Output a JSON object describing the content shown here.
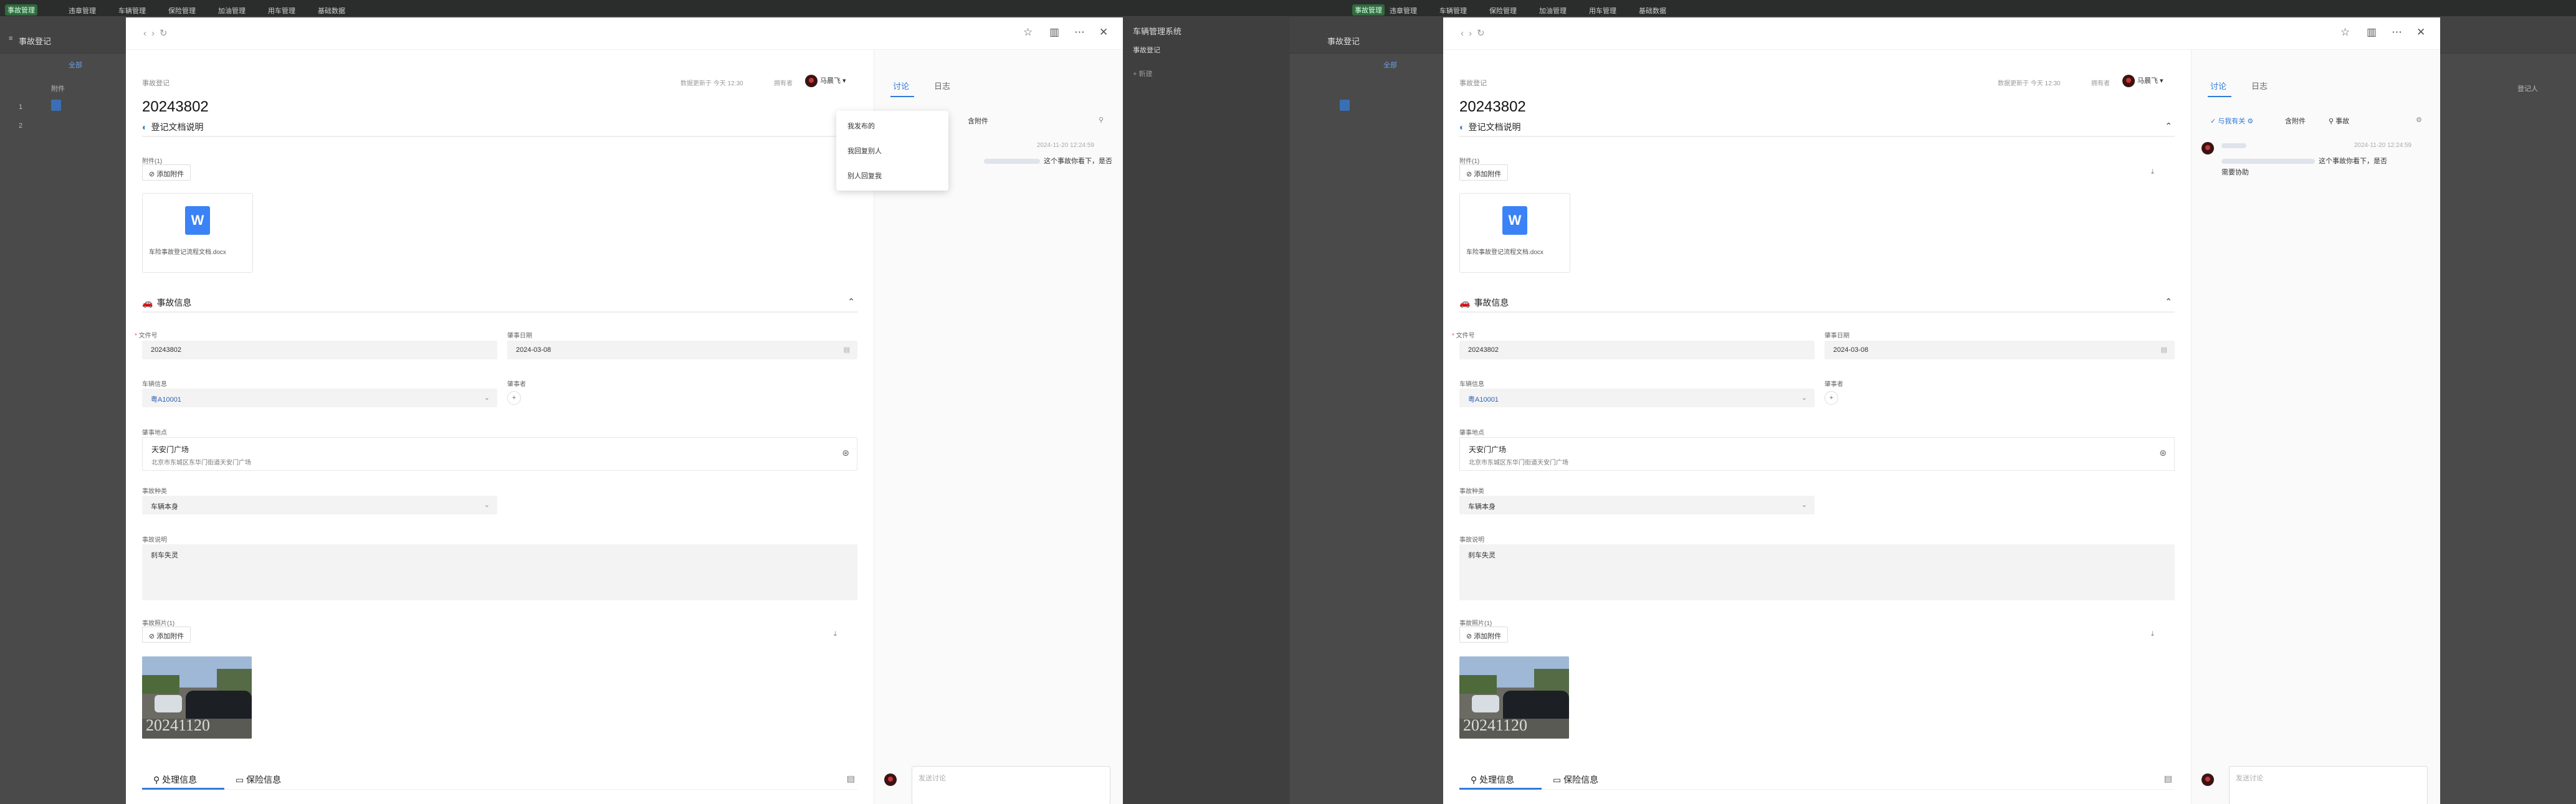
{
  "bg_left": {
    "nav": [
      "事故管理",
      "违章管理",
      "车辆管理",
      "保险管理",
      "加油管理",
      "用车管理",
      "基础数据"
    ],
    "page_title": "事故登记",
    "table_head": [
      "附件"
    ],
    "tab_all": "全部",
    "rows": [
      "1",
      "2"
    ]
  },
  "bg_right": {
    "system_title": "车辆管理系统",
    "sidebar_item": "事故登记",
    "add": "+ 新建",
    "col_head": "登记人"
  },
  "modal": {
    "crumb": "事故登记",
    "doc_no": "20243802",
    "updated": "数据更新于 今天 12:30",
    "owner_label": "拥有者",
    "owner_name": "马晨飞",
    "sections": {
      "attachment_title": "登记文档说明",
      "attachment_count": "附件(1)",
      "add_attachment": "添加附件",
      "file_name": "车险事故登记流程文档.docx",
      "accident_title": "事故信息",
      "process_tab": "处理信息",
      "insurance_tab": "保险信息"
    },
    "fields": {
      "doc_no_label": "文件号",
      "doc_no_value": "20243802",
      "date_label": "肇事日期",
      "date_value": "2024-03-08",
      "vehicle_label": "车辆信息",
      "vehicle_value": "粤A10001",
      "driver_label": "肇事者",
      "place_label": "肇事地点",
      "place_name": "天安门广场",
      "place_address": "北京市东城区东华门街道天安门广场",
      "type_label": "事故种类",
      "type_value": "车辆本身",
      "desc_label": "事故说明",
      "desc_value": "刹车失灵",
      "photo_label": "事故照片(1)",
      "photo_stamp": "20241120"
    }
  },
  "discussion": {
    "tab_discuss": "讨论",
    "tab_log": "日志",
    "filter_me": "与我有关",
    "filter_attach": "含附件",
    "search_value": "事故",
    "time": "2024-11-20 12:24:59",
    "msg_tail": "这个事故你看下，是否",
    "msg_line2": "需要协助",
    "compose_placeholder": "发送讨论",
    "dropdown": [
      "我发布的",
      "我回复别人",
      "别人回复我"
    ]
  }
}
